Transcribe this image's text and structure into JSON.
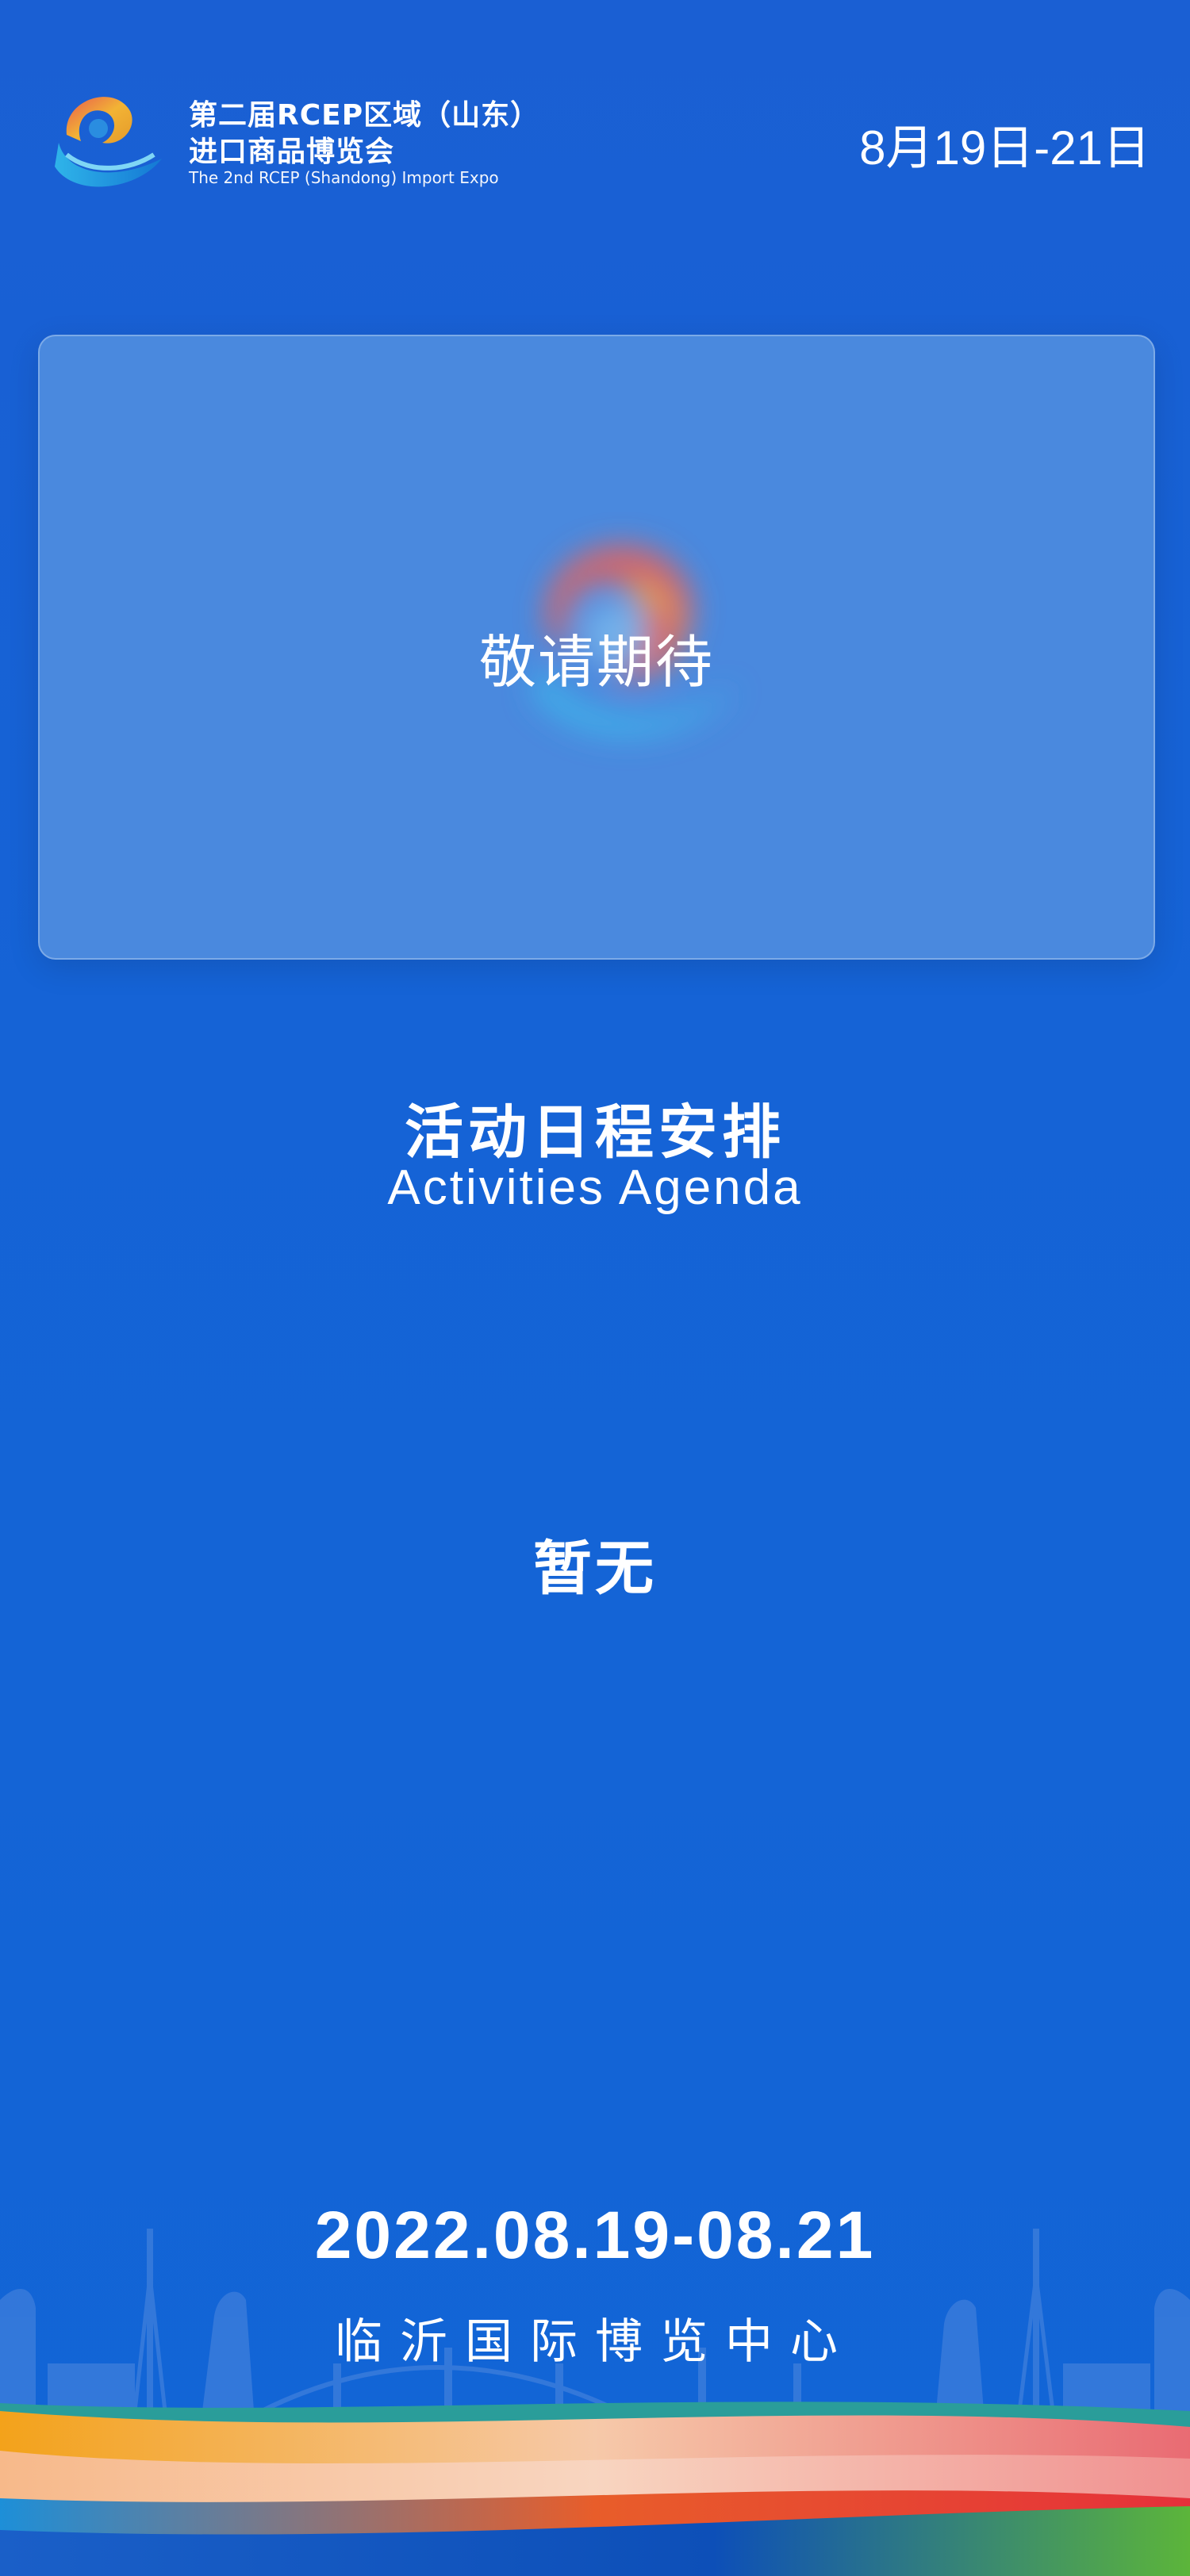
{
  "header": {
    "title_line1": "第二届RCEP区域（山东）",
    "title_line2": "进口商品博览会",
    "title_en": "The 2nd RCEP (Shandong) Import Expo",
    "date": "8月19日-21日"
  },
  "banner": {
    "text": "敬请期待"
  },
  "agenda": {
    "title_cn": "活动日程安排",
    "title_en": "Activities Agenda",
    "empty_text": "暂无"
  },
  "footer": {
    "date_range": "2022.08.19-08.21",
    "venue": "临沂国际博览中心"
  },
  "colors": {
    "background": "#1563d6",
    "banner": "#4a89de",
    "text": "#ffffff"
  },
  "icons": {
    "logo": "expo-logo-icon",
    "banner_art": "expo-logo-blur-icon"
  }
}
